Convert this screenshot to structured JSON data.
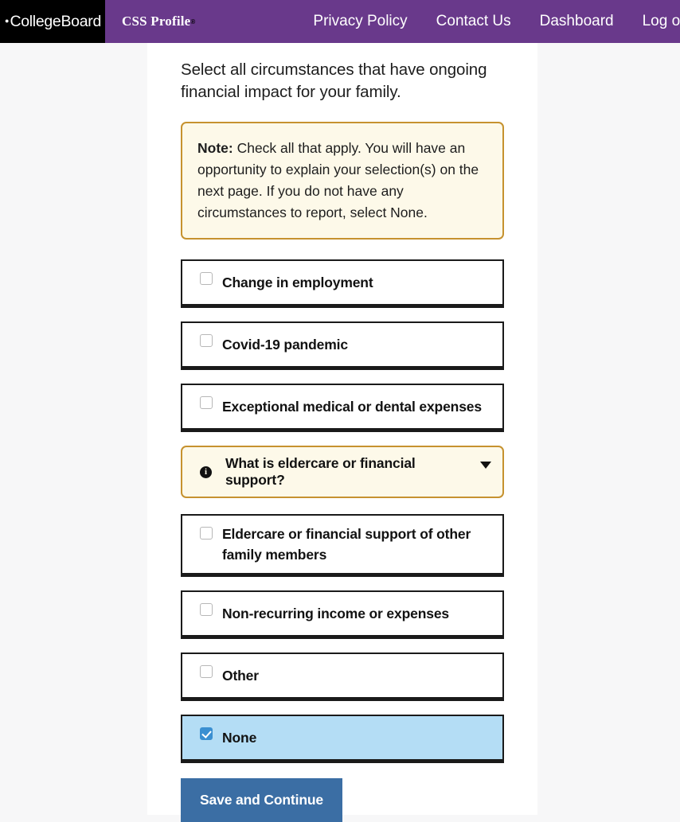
{
  "header": {
    "logo": {
      "acorn_icon": "acorn-icon",
      "text": "CollegeBoard"
    },
    "brand": {
      "text": "CSS Profile",
      "registered_mark": "®"
    },
    "nav": [
      {
        "label": "Privacy Policy"
      },
      {
        "label": "Contact Us"
      },
      {
        "label": "Dashboard"
      },
      {
        "label": "Log out"
      }
    ],
    "colors": {
      "bar": "#69398b",
      "logo_block": "#000000"
    }
  },
  "main": {
    "prompt": "Select all circumstances that have ongoing financial impact for your family.",
    "note": {
      "label": "Note:",
      "body": " Check all that apply. You will have an opportunity to explain your selection(s) on the next page. If you do not have any circumstances to report, select None.",
      "border_color": "#c6922f",
      "background_color": "#fdf9e9"
    },
    "options": [
      {
        "label": "Change in employment",
        "checked": false
      },
      {
        "label": "Covid-19 pandemic",
        "checked": false
      },
      {
        "label": "Exceptional medical or dental expenses",
        "checked": false
      },
      {
        "label": "Eldercare or financial support of other family members",
        "checked": false
      },
      {
        "label": "Non-recurring income or expenses",
        "checked": false
      },
      {
        "label": "Other",
        "checked": false
      },
      {
        "label": "None",
        "checked": true
      }
    ],
    "accordion": {
      "label": "What is eldercare or financial support?",
      "info_icon": "info-circle-icon",
      "caret_icon": "chevron-down-icon",
      "expanded": false
    },
    "submit": {
      "label": "Save and Continue",
      "color": "#3b6ea4"
    },
    "selected_highlight_color": "#b4ddf5"
  }
}
